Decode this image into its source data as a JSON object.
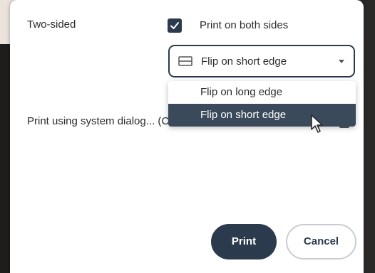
{
  "two_sided": {
    "label": "Two-sided",
    "checkbox_checked": true,
    "checkbox_label": "Print on both sides"
  },
  "flip_select": {
    "selected": "Flip on short edge",
    "icon": "flip-short-edge-icon",
    "options": [
      "Flip on long edge",
      "Flip on short edge"
    ],
    "highlighted_option": "Flip on short edge"
  },
  "system_dialog": {
    "label": "Print using system dialog... (Ctrl+Shift+P)",
    "checked": false
  },
  "buttons": {
    "print": "Print",
    "cancel": "Cancel"
  },
  "colors": {
    "accent": "#2b3a4d",
    "highlight": "#3b4a5b",
    "background_top": "#ece3dc"
  }
}
